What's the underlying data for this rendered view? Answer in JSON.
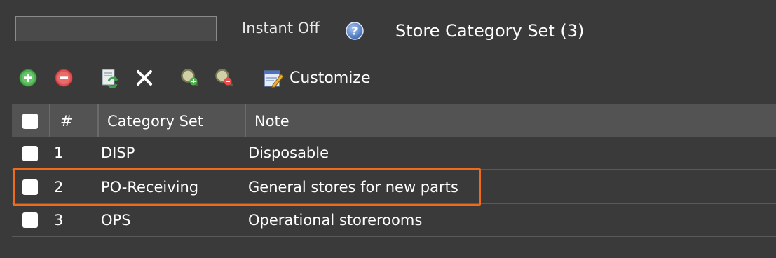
{
  "search": {
    "value": "",
    "placeholder": ""
  },
  "toolbar_top": {
    "instant_toggle_label": "Instant Off",
    "help_icon": "help-icon",
    "title": "Store Category Set (3)"
  },
  "toolbar": {
    "add_icon": "plus-circle-icon",
    "remove_icon": "minus-circle-icon",
    "refresh_icon": "refresh-icon",
    "clear_icon": "close-icon",
    "zoom_in_icon": "zoom-in-icon",
    "zoom_out_icon": "zoom-out-icon",
    "customize_icon": "customize-icon",
    "customize_label": "Customize"
  },
  "table": {
    "columns": [
      "",
      "#",
      "Category Set",
      "Note"
    ],
    "rows": [
      {
        "num": "1",
        "category_set": "DISP",
        "note": "Disposable"
      },
      {
        "num": "2",
        "category_set": "PO-Receiving",
        "note": "General stores for new parts"
      },
      {
        "num": "3",
        "category_set": "OPS",
        "note": "Operational storerooms"
      }
    ],
    "highlighted_row": 2
  },
  "colors": {
    "background": "#3a3a3a",
    "header_background": "#535353",
    "highlight": "#ef6a1a",
    "add_green": "#4caf50",
    "remove_red": "#e05050",
    "help_blue": "#5b86c9"
  }
}
